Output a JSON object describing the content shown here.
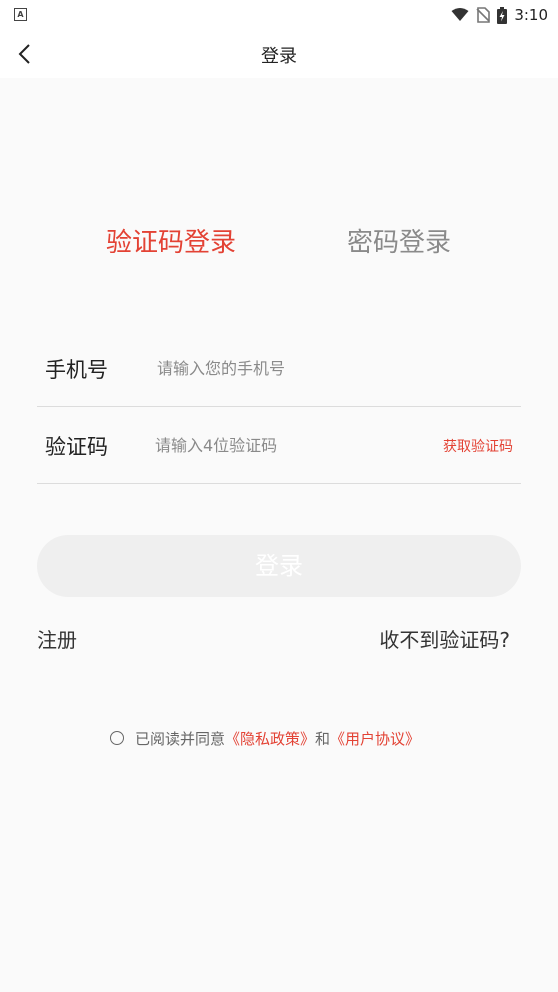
{
  "status_bar": {
    "notification_icon": "A",
    "icons": [
      "wifi-icon",
      "no-sim-icon",
      "battery-charging-icon"
    ],
    "time": "3:10"
  },
  "header": {
    "back_icon": "chevron-left-icon",
    "title": "登录"
  },
  "tabs": [
    {
      "label": "验证码登录",
      "active": true
    },
    {
      "label": "密码登录",
      "active": false
    }
  ],
  "form": {
    "phone_label": "手机号",
    "phone_placeholder": "请输入您的手机号",
    "code_label": "验证码",
    "code_placeholder": "请输入4位验证码",
    "get_code_label": "获取验证码"
  },
  "login_button": "登录",
  "links": {
    "register": "注册",
    "no_code": "收不到验证码?"
  },
  "agreement": {
    "prefix": "已阅读并同意",
    "privacy": "《隐私政策》",
    "and": "和",
    "user_agreement": "《用户协议》",
    "checked": false
  },
  "colors": {
    "accent": "#e34234",
    "inactive_text": "#8a8a8a",
    "button_bg": "#efefef",
    "page_bg": "#fafafa"
  }
}
